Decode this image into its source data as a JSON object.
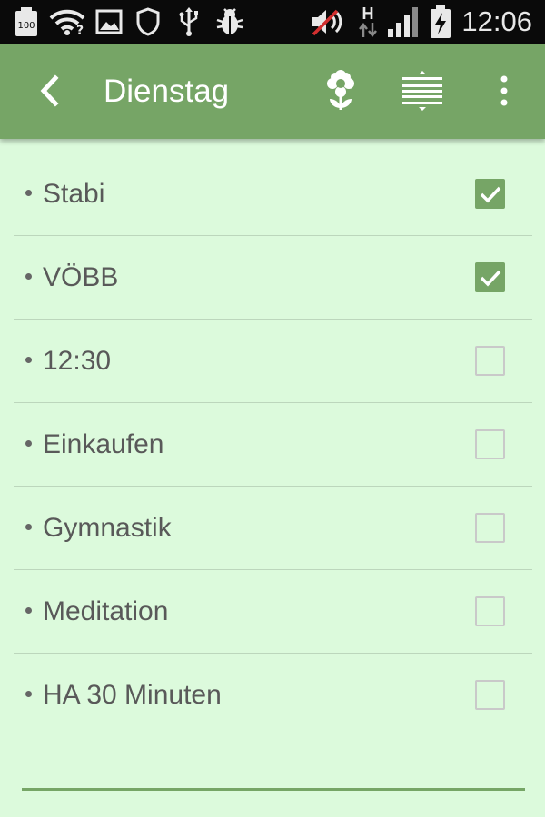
{
  "status_bar": {
    "battery_notice": "100",
    "network_type": "H",
    "time": "12:06",
    "icons": [
      "battery-100-notification-icon",
      "wifi-question-icon",
      "image-icon",
      "shield-icon",
      "usb-icon",
      "bug-icon",
      "muted-speaker-icon",
      "network-h-icon",
      "signal-icon",
      "battery-charging-icon"
    ]
  },
  "app_bar": {
    "title": "Dienstag",
    "actions": [
      "back-icon",
      "flower-icon",
      "expand-collapse-icon",
      "more-vert-icon"
    ]
  },
  "tasks": [
    {
      "label": "Stabi",
      "checked": true
    },
    {
      "label": "VÖBB",
      "checked": true
    },
    {
      "label": "12:30",
      "checked": false
    },
    {
      "label": "Einkaufen",
      "checked": false
    },
    {
      "label": "Gymnastik",
      "checked": false
    },
    {
      "label": "Meditation",
      "checked": false
    },
    {
      "label": "HA 30 Minuten",
      "checked": false
    }
  ],
  "colors": {
    "app_bar": "#76a566",
    "background": "#dcfadc",
    "text": "#595959",
    "checkbox_checked": "#76a566"
  }
}
